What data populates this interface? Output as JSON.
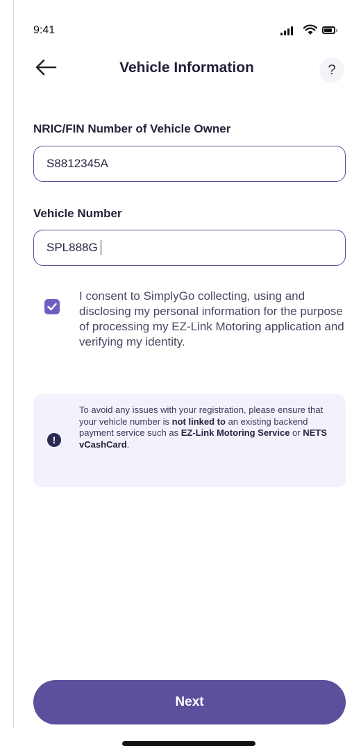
{
  "status_bar": {
    "time": "9:41"
  },
  "header": {
    "title": "Vehicle Information",
    "help_label": "?"
  },
  "form": {
    "nric_label": "NRIC/FIN Number of Vehicle Owner",
    "nric_value": "S8812345A",
    "vehicle_label": "Vehicle Number",
    "vehicle_value": "SPL888G"
  },
  "consent": {
    "checked": true,
    "text": "I consent to SimplyGo collecting, using and disclosing my personal information for the purpose of processing my EZ-Link Motoring application and verifying my identity."
  },
  "notice": {
    "icon": "exclamation-icon",
    "part1": "To avoid any issues with your registration, please ensure that your vehicle number is ",
    "bold1": "not linked to",
    "part2": " an existing backend payment service such as ",
    "bold2": "EZ-Link Motoring Service",
    "part3": " or ",
    "bold3": "NETS vCashCard",
    "part4": "."
  },
  "footer": {
    "next_label": "Next"
  },
  "colors": {
    "accent": "#5c4f9c",
    "checkbox": "#6d5fc2",
    "notice_bg": "#f3f1fc",
    "border": "#5a4f9d"
  }
}
